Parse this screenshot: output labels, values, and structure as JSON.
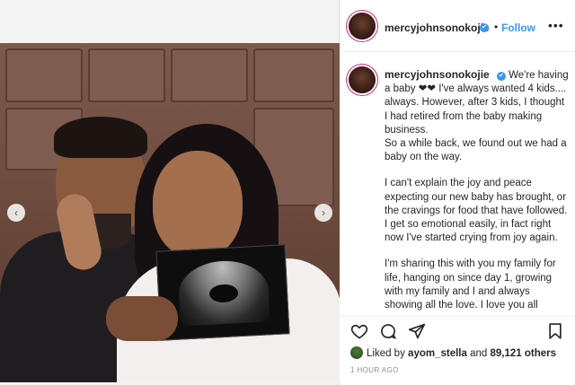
{
  "post": {
    "username": "mercyjohnsonokojie",
    "verified_mark": "✔",
    "separator": "•",
    "follow_label": "Follow",
    "more_label": "•••",
    "caption": [
      "We're having a baby ❤❤ I've always wanted 4 kids.... always. However, after 3 kids, I thought I had retired from the baby making business.",
      "So a while back, we found out we had a baby on the way.",
      "I can't explain the joy and peace expecting our new baby has brought, or the cravings for food that have followed. I get so emotional easily, in fact right now I've started crying from joy again.",
      "I'm sharing this with you my family for life, hanging on since day 1, growing with my family and I and always showing all the love. I love you all"
    ],
    "likes": {
      "prefix": "Liked by",
      "liker": "ayom_stella",
      "conjunction": "and",
      "others": "89,121 others"
    },
    "timestamp": "1 HOUR AGO"
  },
  "carousel": {
    "prev_label": "‹",
    "next_label": "›"
  },
  "icons": {
    "like": "heart-icon",
    "comment": "comment-icon",
    "share": "share-icon",
    "save": "bookmark-icon"
  },
  "colors": {
    "link": "#3897f0",
    "text": "#262626",
    "muted": "#8e8e8e",
    "verified": "#3897f0"
  }
}
